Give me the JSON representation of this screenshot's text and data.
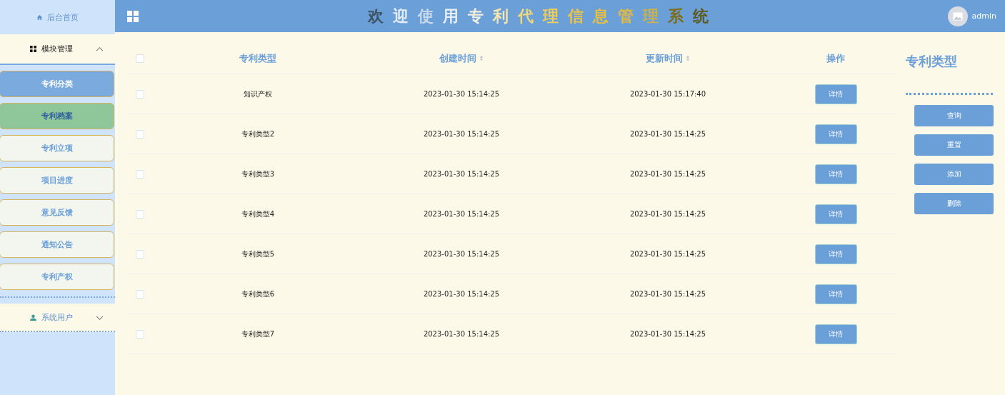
{
  "sidebar": {
    "home": {
      "label": "后台首页"
    },
    "groups": [
      {
        "label": "模块管理",
        "expanded": true,
        "items": [
          {
            "label": "专利分类",
            "selected": true,
            "hovered": false
          },
          {
            "label": "专利档案",
            "selected": false,
            "hovered": true
          },
          {
            "label": "专利立项",
            "selected": false,
            "hovered": false
          },
          {
            "label": "项目进度",
            "selected": false,
            "hovered": false
          },
          {
            "label": "意见反馈",
            "selected": false,
            "hovered": false
          },
          {
            "label": "通知公告",
            "selected": false,
            "hovered": false
          },
          {
            "label": "专利产权",
            "selected": false,
            "hovered": false
          }
        ]
      },
      {
        "label": "系统用户",
        "expanded": false
      }
    ]
  },
  "header": {
    "title": "欢迎使用专利代理信息管理系统",
    "user": "admin"
  },
  "table": {
    "all_checked": false,
    "columns": [
      {
        "label": "专利类型",
        "sortable": false
      },
      {
        "label": "创建时间",
        "sortable": true
      },
      {
        "label": "更新时间",
        "sortable": true
      },
      {
        "label": "操作",
        "sortable": false
      }
    ],
    "rows": [
      {
        "checked": false,
        "cells": [
          "知识产权",
          "2023-01-30 15:14:25",
          "2023-01-30 15:17:40"
        ],
        "action": "详情"
      },
      {
        "checked": false,
        "cells": [
          "专利类型2",
          "2023-01-30 15:14:25",
          "2023-01-30 15:14:25"
        ],
        "action": "详情"
      },
      {
        "checked": false,
        "cells": [
          "专利类型3",
          "2023-01-30 15:14:25",
          "2023-01-30 15:14:25"
        ],
        "action": "详情"
      },
      {
        "checked": false,
        "cells": [
          "专利类型4",
          "2023-01-30 15:14:25",
          "2023-01-30 15:14:25"
        ],
        "action": "详情"
      },
      {
        "checked": false,
        "cells": [
          "专利类型5",
          "2023-01-30 15:14:25",
          "2023-01-30 15:14:25"
        ],
        "action": "详情"
      },
      {
        "checked": false,
        "cells": [
          "专利类型6",
          "2023-01-30 15:14:25",
          "2023-01-30 15:14:25"
        ],
        "action": "详情"
      },
      {
        "checked": false,
        "cells": [
          "专利类型7",
          "2023-01-30 15:14:25",
          "2023-01-30 15:14:25"
        ],
        "action": "详情"
      }
    ]
  },
  "panel": {
    "title": "专利类型",
    "buttons": [
      "查询",
      "重置",
      "添加",
      "删除"
    ]
  }
}
